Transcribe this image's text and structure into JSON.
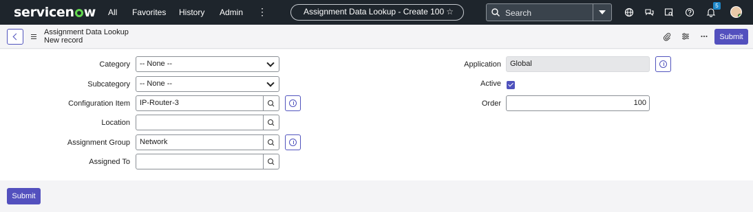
{
  "nav": {
    "logo_pre": "servicen",
    "logo_post": "w",
    "items": [
      "All",
      "Favorites",
      "History",
      "Admin"
    ],
    "more": "⋮",
    "title_pill": "Assignment Data Lookup - Create 100",
    "search_placeholder": "Search",
    "notification_count": "5"
  },
  "header": {
    "title": "Assignment Data Lookup",
    "subtitle": "New record",
    "submit_label": "Submit"
  },
  "form": {
    "left": [
      {
        "label": "Category",
        "value": "-- None --",
        "type": "select"
      },
      {
        "label": "Subcategory",
        "value": "-- None --",
        "type": "select"
      },
      {
        "label": "Configuration Item",
        "value": "IP-Router-3",
        "type": "reference"
      },
      {
        "label": "Location",
        "value": "",
        "type": "reference"
      },
      {
        "label": "Assignment Group",
        "value": "Network",
        "type": "reference"
      },
      {
        "label": "Assigned To",
        "value": "",
        "type": "reference"
      }
    ],
    "right": {
      "application_label": "Application",
      "application_value": "Global",
      "active_label": "Active",
      "active_checked": true,
      "order_label": "Order",
      "order_value": "100"
    }
  },
  "footer": {
    "submit_label": "Submit"
  },
  "colors": {
    "nav_bg": "#1e252c",
    "accent": "#5350be",
    "logo_green": "#62d84e"
  }
}
